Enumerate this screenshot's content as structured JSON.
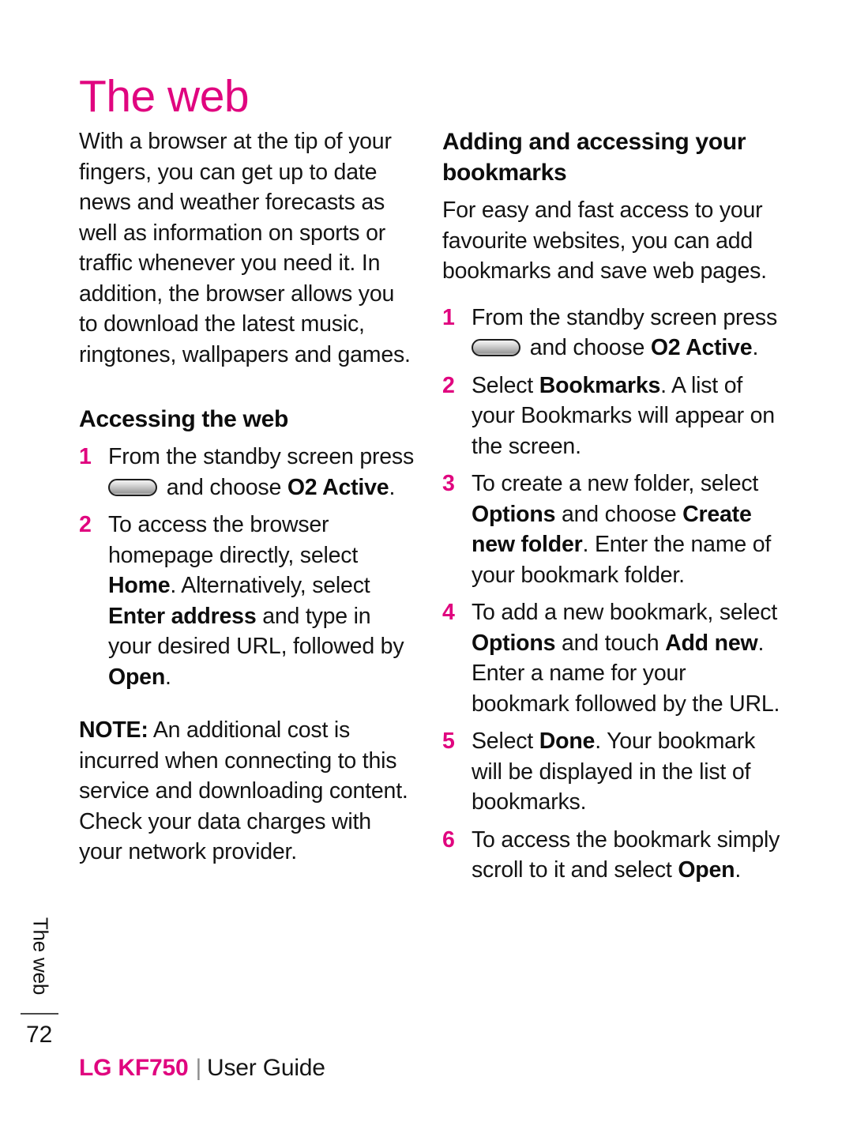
{
  "page": {
    "title": "The web",
    "number": "72",
    "side_tab_label": "The web",
    "accent_color": "#e0057f",
    "text_color": "#141414"
  },
  "footer": {
    "brand": "LG KF750",
    "separator": "|",
    "doc_type": "User Guide"
  },
  "left_column": {
    "intro_paragraph": "With a browser at the tip of your fingers, you can get up to date news and weather forecasts as well as information on sports or traffic whenever you need it. In addition, the browser allows you to download the latest music, ringtones, wallpapers and games.",
    "heading": "Accessing the web",
    "steps": [
      {
        "number": "1",
        "parts": [
          {
            "text": "From the standby screen press ",
            "bold": false
          },
          {
            "icon": "hard-key-capsule-icon"
          },
          {
            "text": " and choose ",
            "bold": false
          },
          {
            "text": "O2 Active",
            "bold": true
          },
          {
            "text": ".",
            "bold": false
          }
        ]
      },
      {
        "number": "2",
        "parts": [
          {
            "text": "To access the browser homepage directly, select ",
            "bold": false
          },
          {
            "text": "Home",
            "bold": true
          },
          {
            "text": ". Alternatively, select ",
            "bold": false
          },
          {
            "text": "Enter address",
            "bold": true
          },
          {
            "text": " and type in your desired URL, followed by ",
            "bold": false
          },
          {
            "text": "Open",
            "bold": true
          },
          {
            "text": ".",
            "bold": false
          }
        ]
      }
    ],
    "note": {
      "label": "NOTE:",
      "text": " An additional cost is incurred when connecting to this service and downloading content. Check your data charges with your network provider."
    }
  },
  "right_column": {
    "heading": "Adding and accessing your bookmarks",
    "intro_paragraph": "For easy and fast access to your favourite websites, you can add bookmarks and save web pages.",
    "steps": [
      {
        "number": "1",
        "parts": [
          {
            "text": "From the standby screen press ",
            "bold": false
          },
          {
            "icon": "hard-key-capsule-icon"
          },
          {
            "text": " and choose ",
            "bold": false
          },
          {
            "text": "O2 Active",
            "bold": true
          },
          {
            "text": ".",
            "bold": false
          }
        ]
      },
      {
        "number": "2",
        "parts": [
          {
            "text": "Select ",
            "bold": false
          },
          {
            "text": "Bookmarks",
            "bold": true
          },
          {
            "text": ". A list of your Bookmarks will appear on the screen.",
            "bold": false
          }
        ]
      },
      {
        "number": "3",
        "parts": [
          {
            "text": "To create a new folder, select ",
            "bold": false
          },
          {
            "text": "Options",
            "bold": true
          },
          {
            "text": " and choose ",
            "bold": false
          },
          {
            "text": "Create new folder",
            "bold": true
          },
          {
            "text": ". Enter the name of your bookmark folder.",
            "bold": false
          }
        ]
      },
      {
        "number": "4",
        "parts": [
          {
            "text": "To add a new bookmark, select ",
            "bold": false
          },
          {
            "text": "Options",
            "bold": true
          },
          {
            "text": " and touch ",
            "bold": false
          },
          {
            "text": "Add new",
            "bold": true
          },
          {
            "text": ". Enter a name for your bookmark followed by the URL.",
            "bold": false
          }
        ]
      },
      {
        "number": "5",
        "parts": [
          {
            "text": "Select ",
            "bold": false
          },
          {
            "text": "Done",
            "bold": true
          },
          {
            "text": ". Your bookmark will be displayed in the list of bookmarks.",
            "bold": false
          }
        ]
      },
      {
        "number": "6",
        "parts": [
          {
            "text": "To access the bookmark simply scroll to it and select ",
            "bold": false
          },
          {
            "text": "Open",
            "bold": true
          },
          {
            "text": ".",
            "bold": false
          }
        ]
      }
    ]
  }
}
